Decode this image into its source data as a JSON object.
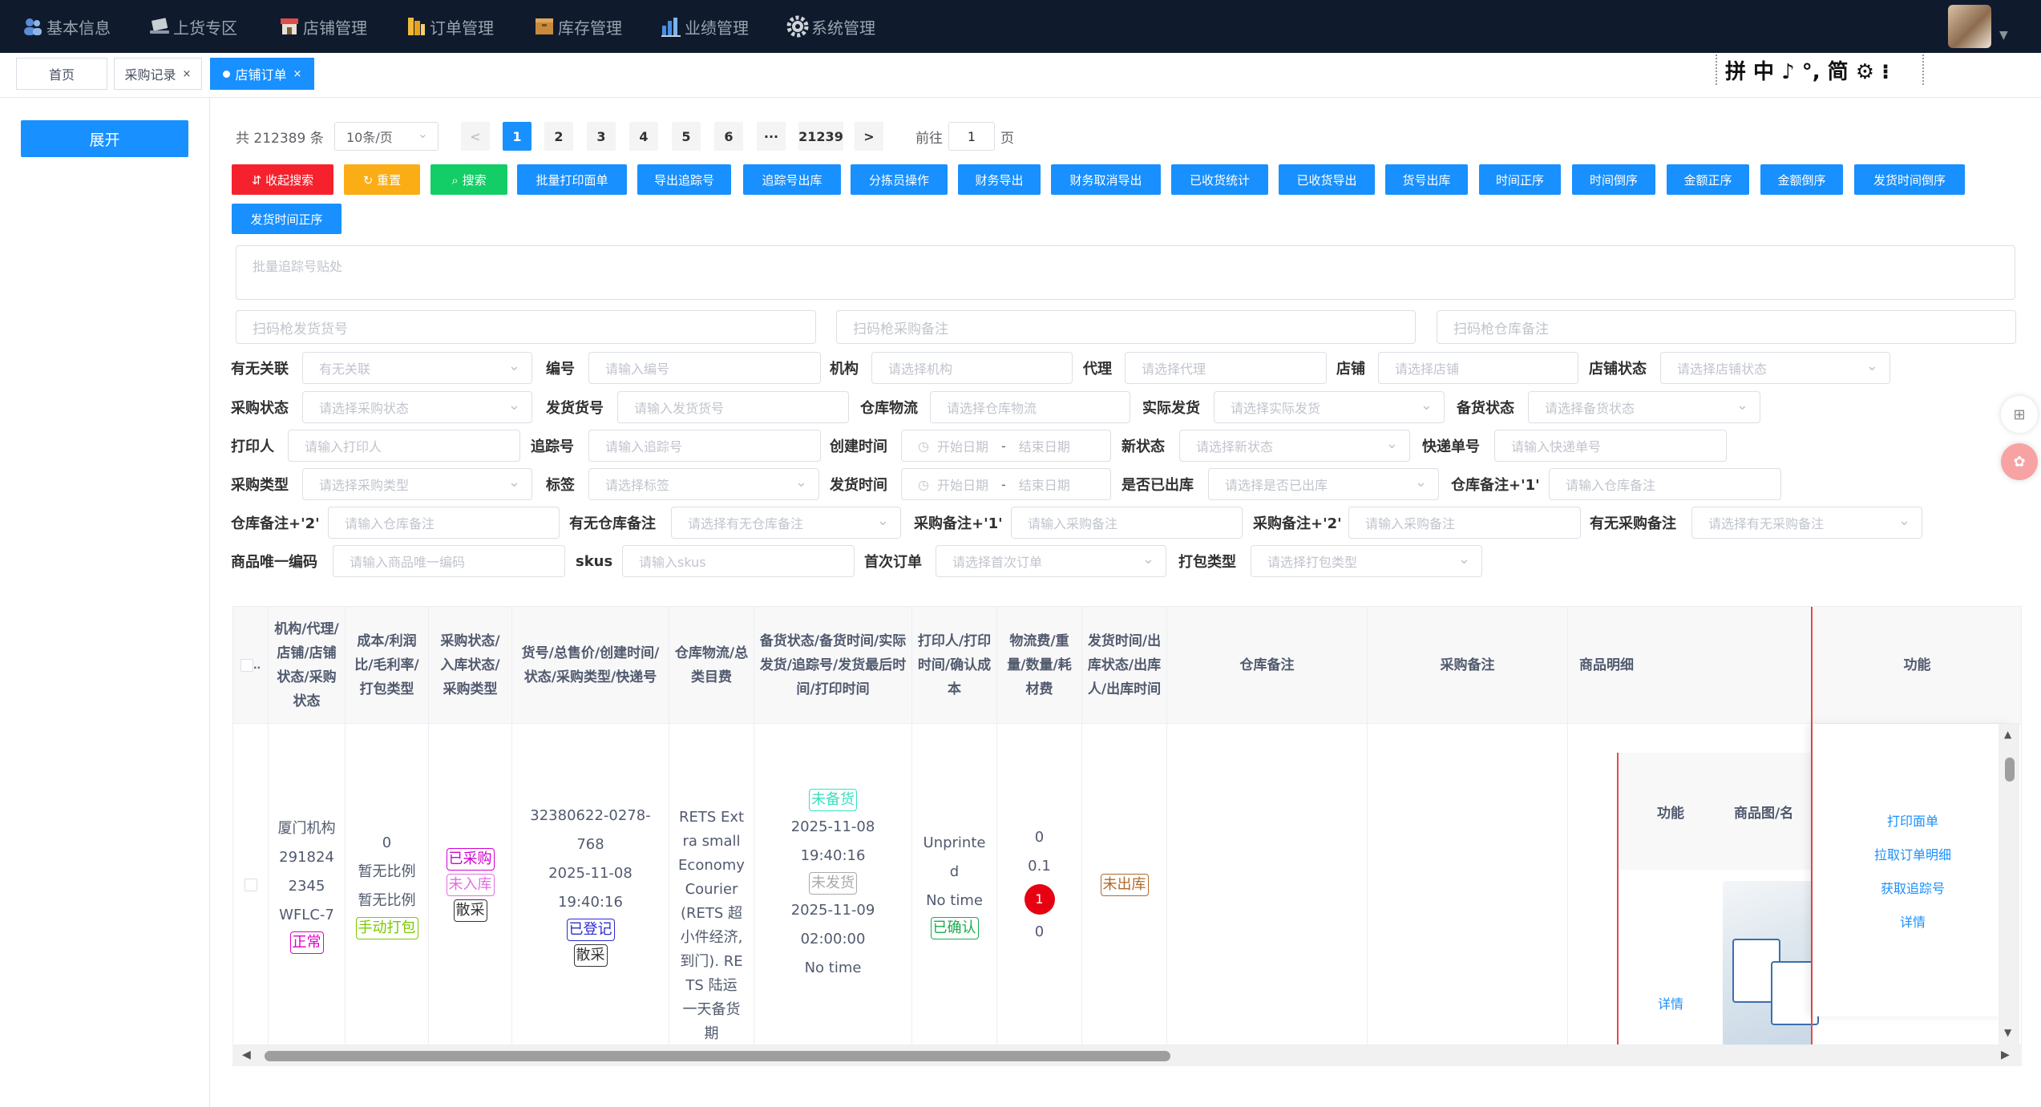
{
  "nav": {
    "items": [
      {
        "label": "基本信息",
        "icon": "users-icon"
      },
      {
        "label": "上货专区",
        "icon": "laptop-icon"
      },
      {
        "label": "店铺管理",
        "icon": "store-icon"
      },
      {
        "label": "订单管理",
        "icon": "order-icon"
      },
      {
        "label": "库存管理",
        "icon": "inventory-icon"
      },
      {
        "label": "业绩管理",
        "icon": "chart-icon"
      },
      {
        "label": "系统管理",
        "icon": "gear-icon"
      }
    ]
  },
  "tabs": [
    {
      "label": "首页"
    },
    {
      "label": "采购记录",
      "close": "×"
    },
    {
      "label": "店铺订单",
      "close": "×",
      "active": true
    }
  ],
  "ime": {
    "text": "拼 中 ♪ °, 简 ⚙ ⁝"
  },
  "sidebar": {
    "expand_label": "展开"
  },
  "pagination": {
    "total": "共 212389 条",
    "page_size": "10条/页",
    "prev": "<",
    "pages": [
      "1",
      "2",
      "3",
      "4",
      "5",
      "6",
      "···",
      "21239"
    ],
    "next": ">",
    "goto_prefix": "前往",
    "goto_value": "1",
    "goto_suffix": "页"
  },
  "actions": {
    "collapse": "⇵ 收起搜索",
    "reset": "↻ 重置",
    "search": "⌕ 搜索",
    "buttons": [
      "批量打印面单",
      "导出追踪号",
      "追踪号出库",
      "分拣员操作",
      "财务导出",
      "财务取消导出",
      "已收货统计",
      "已收货导出",
      "货号出库",
      "时间正序",
      "时间倒序",
      "金额正序",
      "金额倒序",
      "发货时间倒序",
      "发货时间正序"
    ]
  },
  "textarea": {
    "placeholder": "批量追踪号贴处"
  },
  "scan": {
    "ship_no": "扫码枪发货货号",
    "purchase_note": "扫码枪采购备注",
    "warehouse_note": "扫码枪仓库备注"
  },
  "filters": {
    "row1": [
      {
        "label": "有无关联",
        "placeholder": "有无关联"
      },
      {
        "label": "编号",
        "placeholder": "请输入编号"
      },
      {
        "label": "机构",
        "placeholder": "请选择机构"
      },
      {
        "label": "代理",
        "placeholder": "请选择代理"
      },
      {
        "label": "店铺",
        "placeholder": "请选择店铺"
      },
      {
        "label": "店铺状态",
        "placeholder": "请选择店铺状态"
      }
    ],
    "row2": [
      {
        "label": "采购状态",
        "placeholder": "请选择采购状态"
      },
      {
        "label": "发货货号",
        "placeholder": "请输入发货货号"
      },
      {
        "label": "仓库物流",
        "placeholder": "请选择仓库物流"
      },
      {
        "label": "实际发货",
        "placeholder": "请选择实际发货"
      },
      {
        "label": "备货状态",
        "placeholder": "请选择备货状态"
      }
    ],
    "row3": [
      {
        "label": "打印人",
        "placeholder": "请输入打印人"
      },
      {
        "label": "追踪号",
        "placeholder": "请输入追踪号"
      },
      {
        "label": "创建时间",
        "start": "开始日期",
        "sep": "-",
        "end": "结束日期"
      },
      {
        "label": "新状态",
        "placeholder": "请选择新状态"
      },
      {
        "label": "快递单号",
        "placeholder": "请输入快递单号"
      }
    ],
    "row4": [
      {
        "label": "采购类型",
        "placeholder": "请选择采购类型"
      },
      {
        "label": "标签",
        "placeholder": "请选择标签"
      },
      {
        "label": "发货时间",
        "start": "开始日期",
        "sep": "-",
        "end": "结束日期"
      },
      {
        "label": "是否已出库",
        "placeholder": "请选择是否已出库"
      },
      {
        "label": "仓库备注+'1'",
        "placeholder": "请输入仓库备注"
      }
    ],
    "row5": [
      {
        "label": "仓库备注+'2'",
        "placeholder": "请输入仓库备注"
      },
      {
        "label": "有无仓库备注",
        "placeholder": "请选择有无仓库备注"
      },
      {
        "label": "采购备注+'1'",
        "placeholder": "请输入采购备注"
      },
      {
        "label": "采购备注+'2'",
        "placeholder": "请输入采购备注"
      },
      {
        "label": "有无采购备注",
        "placeholder": "请选择有无采购备注"
      }
    ],
    "row6": [
      {
        "label": "商品唯一编码",
        "placeholder": "请输入商品唯一编码"
      },
      {
        "label": "skus",
        "placeholder": "请输入skus"
      },
      {
        "label": "首次订单",
        "placeholder": "请选择首次订单"
      },
      {
        "label": "打包类型",
        "placeholder": "请选择打包类型"
      }
    ]
  },
  "table": {
    "headers": [
      "机构/代理/店铺/店铺状态/采购状态",
      "成本/利润比/毛利率/打包类型",
      "采购状态/入库状态/采购类型",
      "货号/总售价/创建时间/状态/采购类型/快递号",
      "仓库物流/总类目费",
      "备货状态/备货时间/实际发货/追踪号/发货最后时间/打印时间",
      "打印人/打印时间/确认成本",
      "物流费/重量/数量/耗材费",
      "发货时间/出库状态/出库人/出库时间",
      "仓库备注",
      "采购备注",
      "商品明细",
      "功能"
    ],
    "select_col": "..",
    "row": {
      "org": "厦门机构",
      "id": "2918242345",
      "store": "WFLC-7",
      "store_status": "正常",
      "cost": "0",
      "profit_ratio": "暂无比例",
      "margin": "暂无比例",
      "pack_type": "手动打包",
      "purchase_status": "已采购",
      "stock_status": "未入库",
      "purchase_type": "散采",
      "ship_no": "32380622-0278-768",
      "created": "2025-11-08 19:40:16",
      "order_status": "已登记",
      "order_type": "散采",
      "logistics": "RETS Extra small Economy Courier (RETS 超小件经济,到门). RETS 陆运 一天备货期",
      "stock_state": "未备货",
      "stock_time": "2025-11-08 19:40:16",
      "ship_state": "未发货",
      "ship_last": "2025-11-09 02:00:00",
      "print_time": "No time",
      "printer": "Unprinted",
      "printer_time": "No time",
      "confirm": "已确认",
      "fee": "0",
      "weight": "0.1",
      "qty": "1",
      "material": "0",
      "outbound": "未出库"
    },
    "inner": {
      "h_func": "功能",
      "h_img": "商品图/名",
      "detail": "详情"
    },
    "functions": [
      "打印面单",
      "拉取订单明细",
      "获取追踪号",
      "详情"
    ]
  },
  "colors": {
    "primary": "#1890ff",
    "danger": "#f5222d",
    "warning": "#faad14",
    "success": "#13ce66",
    "nav_bg": "#0f1b2d"
  }
}
